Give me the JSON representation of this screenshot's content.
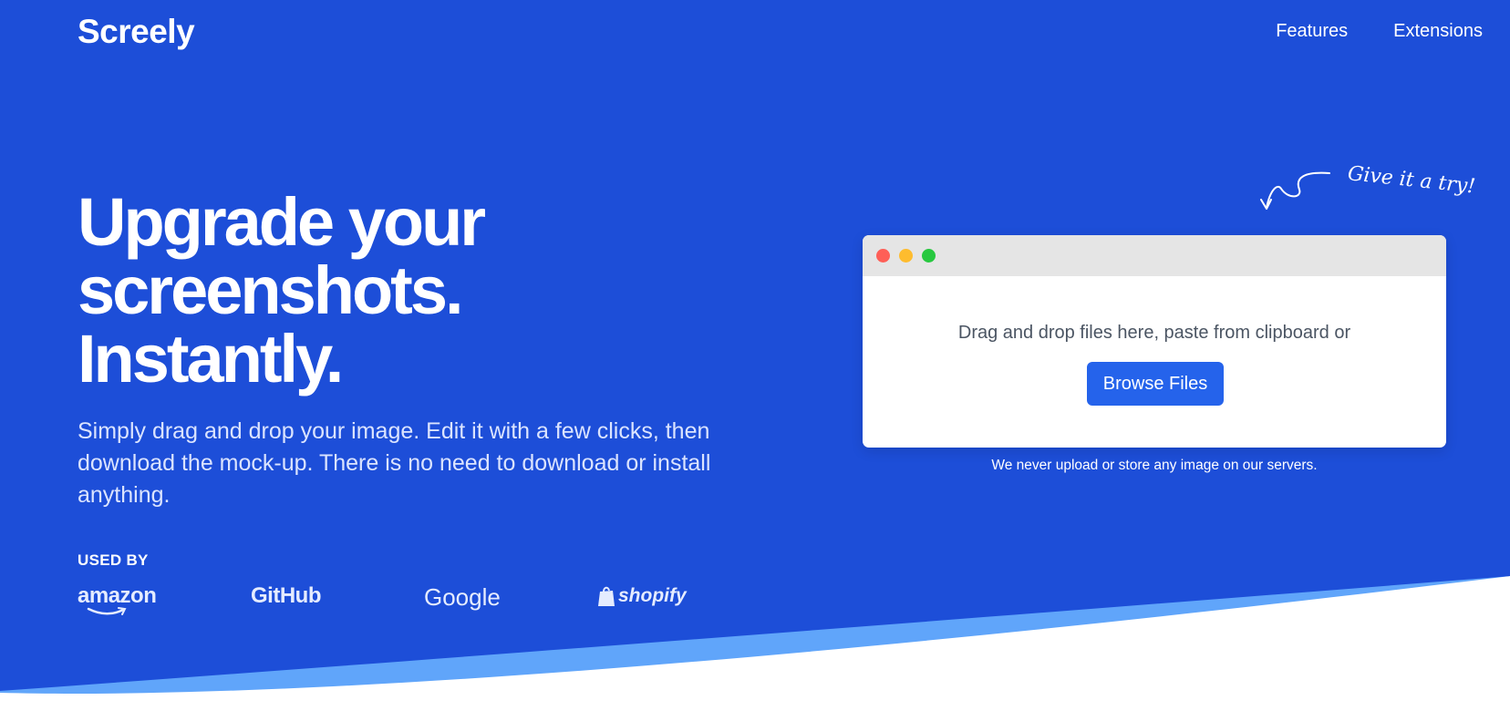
{
  "brand": {
    "name": "Screely"
  },
  "nav": {
    "items": [
      {
        "label": "Features"
      },
      {
        "label": "Extensions"
      }
    ]
  },
  "hero": {
    "headline_lines": [
      "Upgrade your",
      "screenshots.",
      "Instantly."
    ],
    "subtext": "Simply drag and drop your image. Edit it with a few clicks, then download the mock-up. There is no need to download or install anything.",
    "used_by_label": "USED BY",
    "logos": [
      "amazon",
      "GitHub",
      "Google",
      "shopify"
    ]
  },
  "annotation": {
    "text": "Give it a try!"
  },
  "uploader": {
    "drop_text": "Drag and drop files here, paste from clipboard or",
    "browse_label": "Browse Files",
    "privacy_note": "We never upload or store any image on our servers."
  },
  "colors": {
    "background": "#1d4ed8",
    "wave": "#60a5fa",
    "button": "#2563eb",
    "traffic_red": "#fe5f57",
    "traffic_yellow": "#febc2e",
    "traffic_green": "#28c840"
  }
}
